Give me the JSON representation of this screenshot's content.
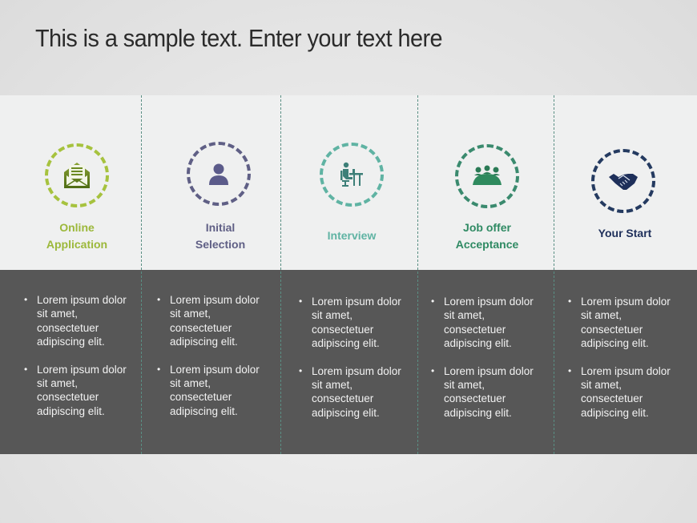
{
  "title": "This is a sample text. Enter your text here",
  "colors": {
    "online_application": "#9cb83a",
    "initial_selection": "#5f5f85",
    "interview": "#5fb3a3",
    "job_offer": "#2f8a63",
    "your_start": "#1e2f5a",
    "dark_band": "#575757",
    "divider": "#5a8f84"
  },
  "steps": [
    {
      "label_line1": "Online",
      "label_line2": "Application",
      "icon": "envelope-letter-icon",
      "bullets": [
        {
          "l1": "Lorem ipsum dolor",
          "l2": "sit amet,",
          "l3": "consectetuer",
          "l4": "adipiscing elit."
        },
        {
          "l1": "Lorem ipsum dolor",
          "l2": "sit amet,",
          "l3": "consectetuer",
          "l4": "adipiscing elit."
        }
      ]
    },
    {
      "label_line1": "Initial",
      "label_line2": "Selection",
      "icon": "user-icon",
      "bullets": [
        {
          "l1": "Lorem ipsum dolor",
          "l2": "sit amet,",
          "l3": "consectetuer",
          "l4": "adipiscing elit."
        },
        {
          "l1": "Lorem ipsum dolor",
          "l2": "sit amet,",
          "l3": "consectetuer",
          "l4": "adipiscing elit."
        }
      ]
    },
    {
      "label_line1": "Interview",
      "label_line2": "",
      "icon": "person-at-desk-icon",
      "bullets": [
        {
          "l1": "Lorem ipsum dolor",
          "l2": "sit amet,",
          "l3": "consectetuer",
          "l4": "adipiscing elit."
        },
        {
          "l1": "Lorem ipsum dolor",
          "l2": "sit amet,",
          "l3": "consectetuer",
          "l4": "adipiscing elit."
        }
      ]
    },
    {
      "label_line1": "Job offer",
      "label_line2": "Acceptance",
      "icon": "meeting-group-icon",
      "bullets": [
        {
          "l1": "Lorem ipsum dolor",
          "l2": "sit amet,",
          "l3": "consectetuer",
          "l4": "adipiscing elit."
        },
        {
          "l1": "Lorem ipsum dolor",
          "l2": "sit amet,",
          "l3": "consectetuer",
          "l4": "adipiscing elit."
        }
      ]
    },
    {
      "label_line1": "Your Start",
      "label_line2": "",
      "icon": "handshake-icon",
      "bullets": [
        {
          "l1": "Lorem ipsum dolor",
          "l2": "sit amet,",
          "l3": "consectetuer",
          "l4": "adipiscing elit."
        },
        {
          "l1": "Lorem ipsum dolor",
          "l2": "sit amet,",
          "l3": "consectetuer",
          "l4": "adipiscing elit."
        }
      ]
    }
  ]
}
